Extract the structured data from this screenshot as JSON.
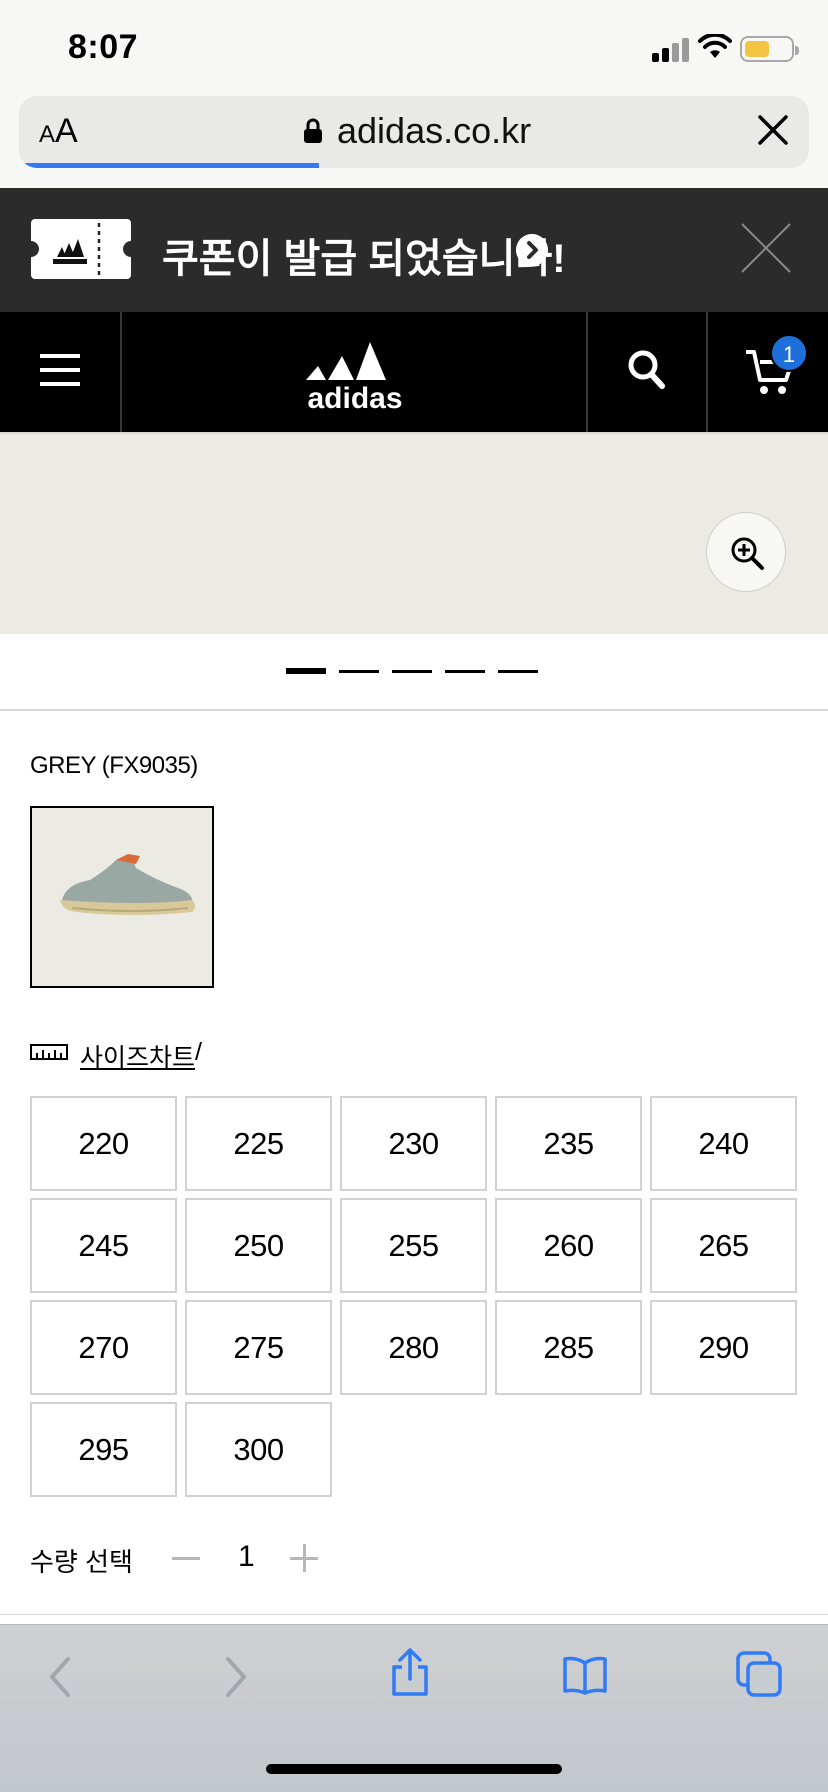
{
  "status": {
    "time": "8:07",
    "battery_color": "#f4c542"
  },
  "browser": {
    "text_size_label_small": "A",
    "text_size_label_large": "A",
    "url": "adidas.co.kr",
    "load_progress": 0.38,
    "progress_color": "#3478f6"
  },
  "coupon": {
    "text": "쿠폰이 발급 되었습니다!"
  },
  "nav": {
    "cart_count": "1",
    "badge_color": "#1e6fd9"
  },
  "gallery": {
    "page_count": 5,
    "active_index": 0
  },
  "product": {
    "color_label": "GREY (FX9035)",
    "size_chart_label": "사이즈차트",
    "size_chart_separator": "/",
    "sizes": [
      "220",
      "225",
      "230",
      "235",
      "240",
      "245",
      "250",
      "255",
      "260",
      "265",
      "270",
      "275",
      "280",
      "285",
      "290",
      "295",
      "300"
    ],
    "quantity_label": "수량 선택",
    "quantity": "1"
  },
  "icons": [
    "signal-icon",
    "wifi-icon",
    "battery-icon",
    "lock-icon",
    "close-icon",
    "ticket-icon",
    "chevron-right-icon",
    "menu-icon",
    "adidas-logo",
    "search-icon",
    "cart-icon",
    "zoom-in-icon",
    "ruler-icon",
    "back-icon",
    "forward-icon",
    "share-icon",
    "bookmarks-icon",
    "tabs-icon"
  ]
}
